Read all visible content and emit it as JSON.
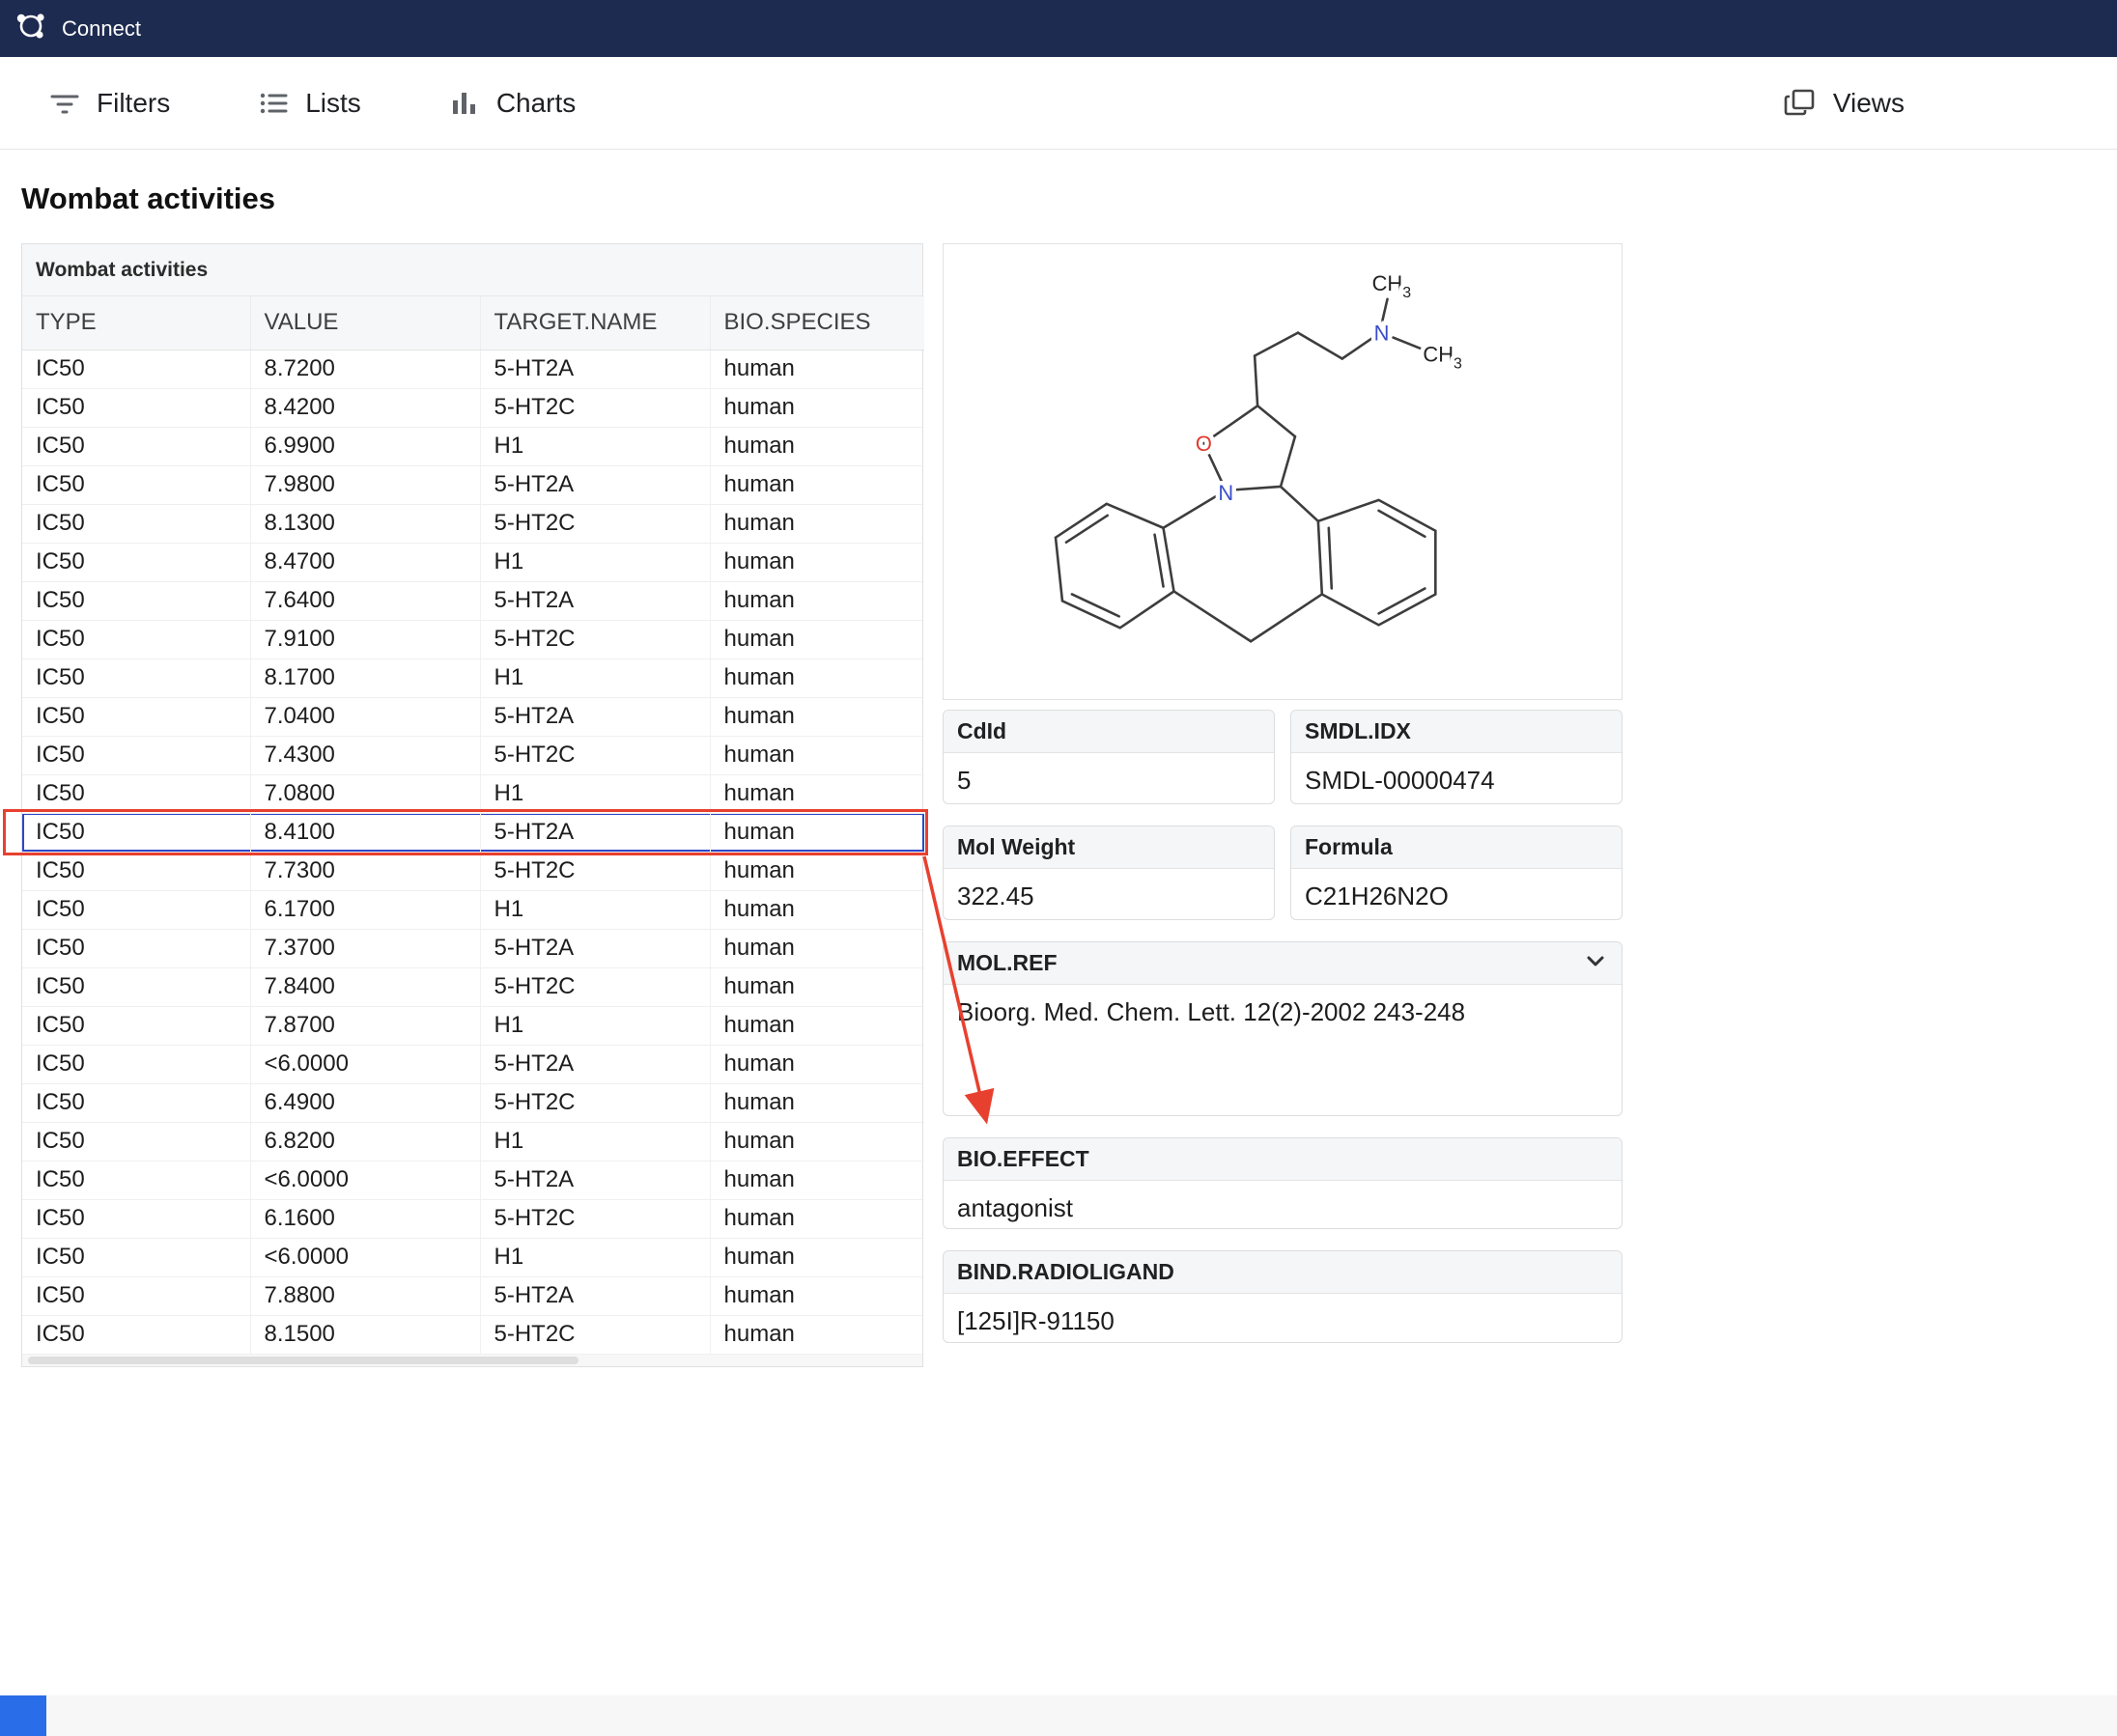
{
  "colors": {
    "topbar-bg": "#1e2b50",
    "selection-blue": "#2e46c9",
    "annotation-red": "#e8402f",
    "footer-accent-blue": "#2a6de8",
    "atom-n-blue": "#3a4ecb",
    "atom-o-red": "#e03a31"
  },
  "topbar": {
    "app_name": "Connect"
  },
  "toolbar": {
    "filters_label": "Filters",
    "lists_label": "Lists",
    "charts_label": "Charts",
    "views_label": "Views"
  },
  "page": {
    "title": "Wombat activities"
  },
  "table": {
    "panel_title": "Wombat activities",
    "columns": [
      "TYPE",
      "VALUE",
      "TARGET.NAME",
      "BIO.SPECIES"
    ],
    "selected_row_index": 12,
    "rows": [
      [
        "IC50",
        "8.7200",
        "5-HT2A",
        "human"
      ],
      [
        "IC50",
        "8.4200",
        "5-HT2C",
        "human"
      ],
      [
        "IC50",
        "6.9900",
        "H1",
        "human"
      ],
      [
        "IC50",
        "7.9800",
        "5-HT2A",
        "human"
      ],
      [
        "IC50",
        "8.1300",
        "5-HT2C",
        "human"
      ],
      [
        "IC50",
        "8.4700",
        "H1",
        "human"
      ],
      [
        "IC50",
        "7.6400",
        "5-HT2A",
        "human"
      ],
      [
        "IC50",
        "7.9100",
        "5-HT2C",
        "human"
      ],
      [
        "IC50",
        "8.1700",
        "H1",
        "human"
      ],
      [
        "IC50",
        "7.0400",
        "5-HT2A",
        "human"
      ],
      [
        "IC50",
        "7.4300",
        "5-HT2C",
        "human"
      ],
      [
        "IC50",
        "7.0800",
        "H1",
        "human"
      ],
      [
        "IC50",
        "8.4100",
        "5-HT2A",
        "human"
      ],
      [
        "IC50",
        "7.7300",
        "5-HT2C",
        "human"
      ],
      [
        "IC50",
        "6.1700",
        "H1",
        "human"
      ],
      [
        "IC50",
        "7.3700",
        "5-HT2A",
        "human"
      ],
      [
        "IC50",
        "7.8400",
        "5-HT2C",
        "human"
      ],
      [
        "IC50",
        "7.8700",
        "H1",
        "human"
      ],
      [
        "IC50",
        "<6.0000",
        "5-HT2A",
        "human"
      ],
      [
        "IC50",
        "6.4900",
        "5-HT2C",
        "human"
      ],
      [
        "IC50",
        "6.8200",
        "H1",
        "human"
      ],
      [
        "IC50",
        "<6.0000",
        "5-HT2A",
        "human"
      ],
      [
        "IC50",
        "6.1600",
        "5-HT2C",
        "human"
      ],
      [
        "IC50",
        "<6.0000",
        "H1",
        "human"
      ],
      [
        "IC50",
        "7.8800",
        "5-HT2A",
        "human"
      ],
      [
        "IC50",
        "8.1500",
        "5-HT2C",
        "human"
      ]
    ]
  },
  "details": {
    "molecule": {
      "n_label": "N",
      "o_label": "O",
      "methyl_label": "CH",
      "methyl_sub": "3"
    },
    "fields": [
      {
        "label": "CdId",
        "value": "5"
      },
      {
        "label": "SMDL.IDX",
        "value": "SMDL-00000474"
      },
      {
        "label": "Mol Weight",
        "value": "322.45"
      },
      {
        "label": "Formula",
        "value": "C21H26N2O"
      },
      {
        "label": "MOL.REF",
        "value": "Bioorg. Med. Chem. Lett. 12(2)-2002 243-248"
      },
      {
        "label": "BIO.EFFECT",
        "value": "antagonist"
      },
      {
        "label": "BIND.RADIOLIGAND",
        "value": "[125I]R-91150"
      }
    ]
  }
}
